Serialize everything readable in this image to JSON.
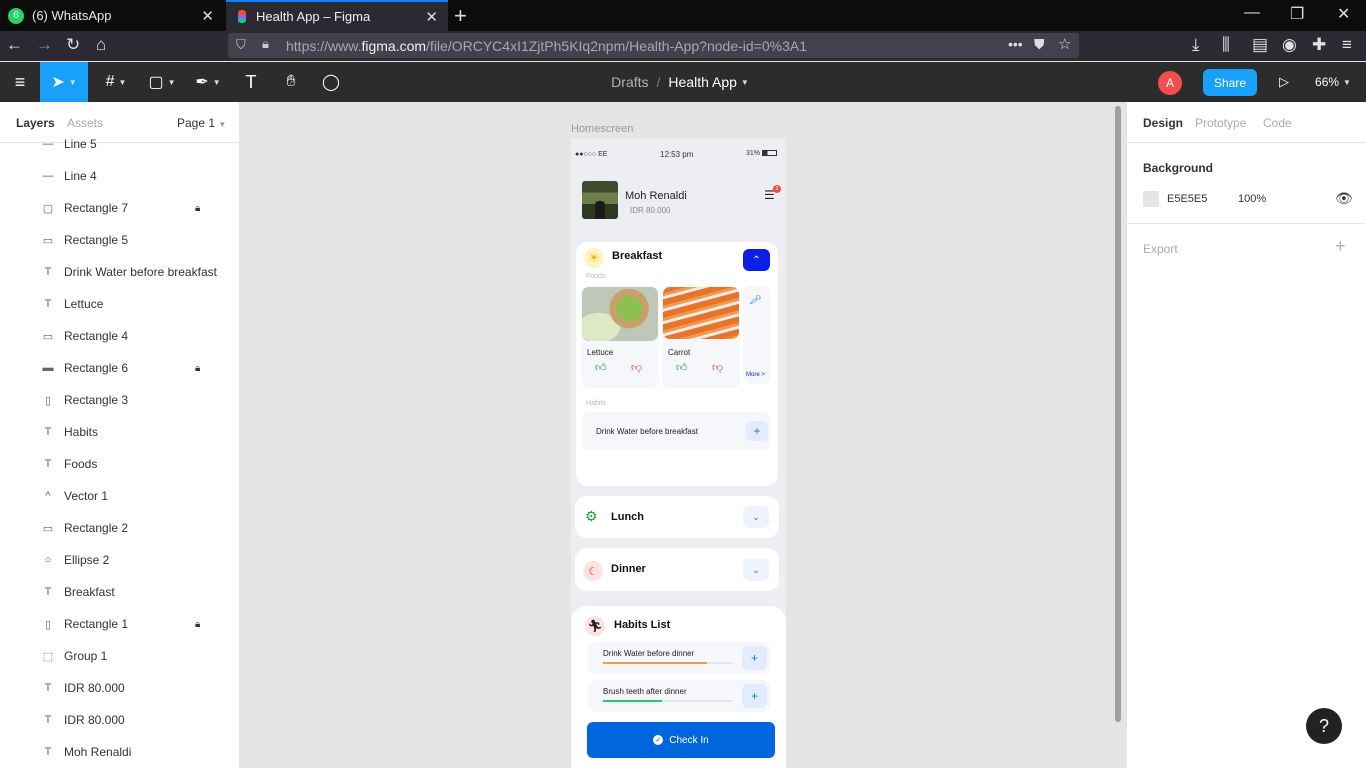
{
  "browser": {
    "tabs": [
      {
        "title": "(6) WhatsApp",
        "badge": "6"
      },
      {
        "title": "Health App – Figma"
      }
    ],
    "url_prefix": "https://www.",
    "url_domain": "figma.com",
    "url_path": "/file/ORCYC4xI1ZjtPh5KIq2npm/Health-App?node-id=0%3A1"
  },
  "toolbar": {
    "breadcrumb_drafts": "Drafts",
    "breadcrumb_sep": "/",
    "file_name": "Health App",
    "avatar_letter": "A",
    "share_label": "Share",
    "zoom": "66%"
  },
  "left_panel": {
    "tab_layers": "Layers",
    "tab_assets": "Assets",
    "page": "Page 1",
    "layers": [
      {
        "name": "Line 5",
        "icon": "line-icon",
        "glyph": "—",
        "locked": false
      },
      {
        "name": "Line 4",
        "icon": "line-icon",
        "glyph": "—",
        "locked": false
      },
      {
        "name": "Rectangle 7",
        "icon": "rectangle-icon",
        "glyph": "▢",
        "locked": true
      },
      {
        "name": "Rectangle 5",
        "icon": "rectangle-icon",
        "glyph": "▭",
        "locked": false
      },
      {
        "name": "Drink Water before breakfast",
        "icon": "text-icon",
        "glyph": "T",
        "locked": false
      },
      {
        "name": "Lettuce",
        "icon": "text-icon",
        "glyph": "T",
        "locked": false
      },
      {
        "name": "Rectangle 4",
        "icon": "rectangle-icon",
        "glyph": "▭",
        "locked": false
      },
      {
        "name": "Rectangle 6",
        "icon": "rectangle-icon",
        "glyph": "▬",
        "locked": true
      },
      {
        "name": "Rectangle 3",
        "icon": "rectangle-icon",
        "glyph": "▯",
        "locked": false
      },
      {
        "name": "Habits",
        "icon": "text-icon",
        "glyph": "T",
        "locked": false
      },
      {
        "name": "Foods",
        "icon": "text-icon",
        "glyph": "T",
        "locked": false
      },
      {
        "name": "Vector 1",
        "icon": "vector-icon",
        "glyph": "^",
        "locked": false
      },
      {
        "name": "Rectangle 2",
        "icon": "rectangle-icon",
        "glyph": "▭",
        "locked": false
      },
      {
        "name": "Ellipse 2",
        "icon": "ellipse-icon",
        "glyph": "○",
        "locked": false
      },
      {
        "name": "Breakfast",
        "icon": "text-icon",
        "glyph": "T",
        "locked": false
      },
      {
        "name": "Rectangle 1",
        "icon": "rectangle-icon",
        "glyph": "▯",
        "locked": true
      },
      {
        "name": "Group 1",
        "icon": "group-icon",
        "glyph": "⬚",
        "locked": false
      },
      {
        "name": "IDR 80.000",
        "icon": "text-icon",
        "glyph": "T",
        "locked": false
      },
      {
        "name": "IDR 80.000",
        "icon": "text-icon",
        "glyph": "T",
        "locked": false
      },
      {
        "name": "Moh Renaldi",
        "icon": "text-icon",
        "glyph": "T",
        "locked": false
      }
    ]
  },
  "right_panel": {
    "tab_design": "Design",
    "tab_prototype": "Prototype",
    "tab_code": "Code",
    "background_label": "Background",
    "background_hex": "E5E5E5",
    "background_opacity": "100%",
    "export_label": "Export"
  },
  "canvas": {
    "frame_label": "Homescreen",
    "status": {
      "carrier": "●●○○○ EE",
      "time": "12:53 pm",
      "battery": "31%"
    },
    "user": {
      "name": "Moh Renaldi",
      "balance": "IDR 80.000",
      "notification_count": "2"
    },
    "breakfast": {
      "title": "Breakfast",
      "foods_label": "Foods",
      "foods": [
        {
          "name": "Lettuce"
        },
        {
          "name": "Carrot"
        }
      ],
      "more_label": "More >",
      "habits_label": "Habits",
      "habit": "Drink Water before breakfast"
    },
    "lunch": {
      "title": "Lunch"
    },
    "dinner": {
      "title": "Dinner"
    },
    "habits_list": {
      "title": "Habits List",
      "items": [
        {
          "name": "Drink Water before dinner",
          "progress": 0.8
        },
        {
          "name": "Brush teeth after dinner",
          "progress": 0.45
        }
      ]
    },
    "check_in_label": "Check In"
  },
  "colors": {
    "figma_blue": "#18a0fb",
    "accent_blue": "#0066dd",
    "like_green": "#1e9e3a",
    "dislike_red": "#e53935",
    "avatar_orange": "#f24e4e"
  }
}
